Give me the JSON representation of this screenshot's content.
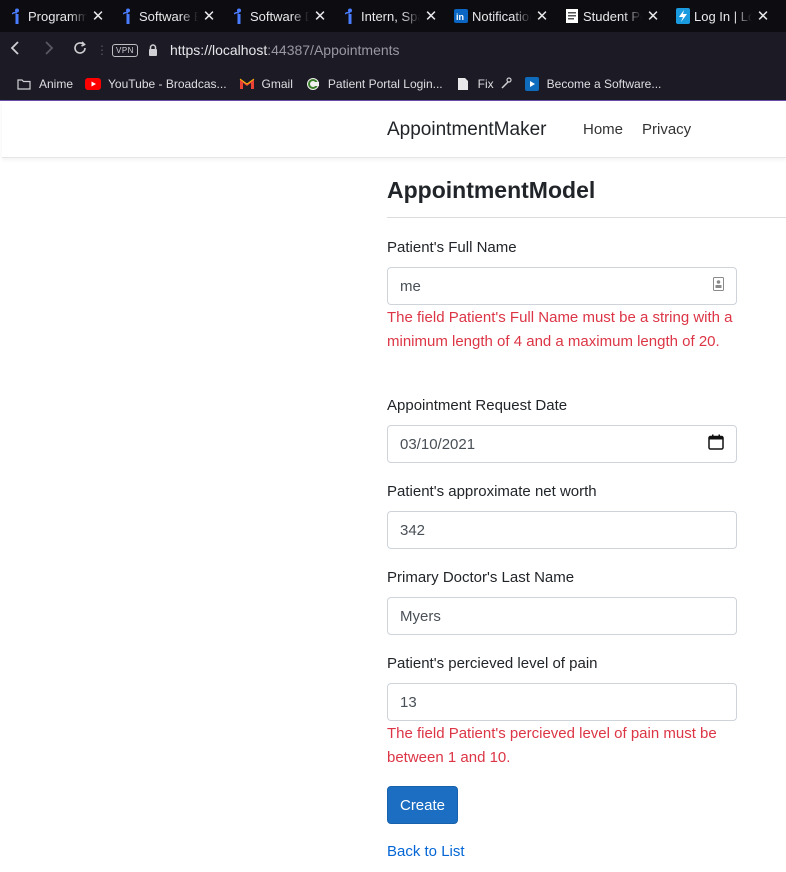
{
  "browser": {
    "tabs": [
      {
        "title": "Programming",
        "icon": "handshake-i-icon"
      },
      {
        "title": "Software Engineer",
        "icon": "handshake-i-icon"
      },
      {
        "title": "Software Developer",
        "icon": "handshake-i-icon"
      },
      {
        "title": "Intern, Spa",
        "icon": "handshake-i-icon"
      },
      {
        "title": "Notifications",
        "icon": "linkedin-icon"
      },
      {
        "title": "Student Po",
        "icon": "document-icon"
      },
      {
        "title": "Log In | Lo",
        "icon": "bolt-icon"
      }
    ],
    "vpn_label": "VPN",
    "url_main": "https://localhost",
    "url_rest": ":44387/Appointments",
    "bookmarks": [
      {
        "label": "Anime",
        "icon": "folder-icon"
      },
      {
        "label": "YouTube - Broadcas...",
        "icon": "youtube-icon"
      },
      {
        "label": "Gmail",
        "icon": "gmail-icon"
      },
      {
        "label": "Patient Portal Login...",
        "icon": "portal-icon"
      },
      {
        "label": "Fix",
        "icon": "page-icon"
      },
      {
        "label": "Become a Software...",
        "icon": "app-icon"
      }
    ]
  },
  "navbar": {
    "brand": "AppointmentMaker",
    "links": [
      "Home",
      "Privacy"
    ]
  },
  "form": {
    "title": "AppointmentModel",
    "fields": [
      {
        "label": "Patient's Full Name",
        "value": "me",
        "error": "The field Patient's Full Name must be a string with a minimum length of 4 and a maximum length of 20."
      },
      {
        "label": "Appointment Request Date",
        "value": "03/10/2021"
      },
      {
        "label": "Patient's approximate net worth",
        "value": "342"
      },
      {
        "label": "Primary Doctor's Last Name",
        "value": "Myers"
      },
      {
        "label": "Patient's percieved level of pain",
        "value": "13",
        "error": "The field Patient's percieved level of pain must be between 1 and 10."
      }
    ],
    "submit_label": "Create",
    "back_link": "Back to List"
  },
  "colors": {
    "error": "#dc3545",
    "primary_button": "#1b6ec2",
    "link": "#0366d6"
  }
}
